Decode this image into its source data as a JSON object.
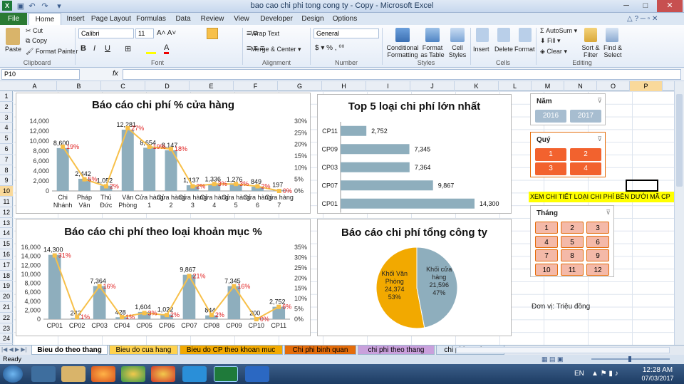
{
  "window": {
    "title": "bao cao chi phi tong cong ty - Copy  -  Microsoft Excel"
  },
  "tabs": [
    "File",
    "Home",
    "Insert",
    "Page Layout",
    "Formulas",
    "Data",
    "Review",
    "View",
    "Developer",
    "Design",
    "Options"
  ],
  "ribbon": {
    "clipboard": {
      "paste": "Paste",
      "cut": "Cut",
      "copy": "Copy",
      "format_painter": "Format Painter",
      "label": "Clipboard"
    },
    "font": {
      "name": "Calibri",
      "size": "11",
      "label": "Font"
    },
    "alignment": {
      "wrap": "Wrap Text",
      "merge": "Merge & Center",
      "label": "Alignment"
    },
    "number": {
      "format": "General",
      "label": "Number"
    },
    "styles": {
      "cond": "Conditional Formatting",
      "table": "Format as Table",
      "cell": "Cell Styles",
      "label": "Styles"
    },
    "cells": {
      "insert": "Insert",
      "delete": "Delete",
      "format": "Format",
      "label": "Cells"
    },
    "editing": {
      "autosum": "AutoSum",
      "fill": "Fill",
      "clear": "Clear",
      "sort": "Sort & Filter",
      "find": "Find & Select",
      "label": "Editing"
    }
  },
  "formula_bar": {
    "name_box": "P10",
    "fx": "fx",
    "content": ""
  },
  "columns": [
    "A",
    "B",
    "C",
    "D",
    "E",
    "F",
    "G",
    "H",
    "I",
    "J",
    "K",
    "L",
    "M",
    "N",
    "O",
    "P"
  ],
  "rows": [
    "1",
    "2",
    "3",
    "4",
    "5",
    "6",
    "7",
    "8",
    "9",
    "10",
    "11",
    "12",
    "13",
    "14",
    "15",
    "16",
    "17",
    "18",
    "19",
    "20",
    "21",
    "22",
    "23",
    "24"
  ],
  "charts": {
    "store": {
      "title": "Báo cáo chi phí % cửa hàng",
      "categories": [
        "Chi Nhánh",
        "Pháp Vân",
        "Thủ Đức",
        "Văn Phòng",
        "Cửa hàng 1",
        "Cửa hàng 2",
        "Cửa hàng 3",
        "Cửa hàng 4",
        "Cửa hàng 5",
        "Cửa hàng 6",
        "Cửa hàng 7"
      ],
      "values": [
        8600,
        2442,
        1052,
        12281,
        8654,
        8147,
        1137,
        1336,
        1276,
        849,
        197
      ],
      "value_labels": [
        "8,600",
        "2,442",
        "1,052",
        "12,281",
        "8,654",
        "8,147",
        "1,137",
        "1,336",
        "1,276",
        "849",
        "197"
      ],
      "pct": [
        19,
        5,
        2,
        27,
        19,
        18,
        2,
        3,
        3,
        2,
        0
      ],
      "pct_labels": [
        "19%",
        "5%",
        "2%",
        "27%",
        "19%",
        "18%",
        "2%",
        "3%",
        "3%",
        "2%",
        "0%"
      ],
      "yticks": [
        "14,000",
        "12,000",
        "10,000",
        "8,000",
        "6,000",
        "4,000",
        "2,000",
        "0"
      ],
      "y2ticks": [
        "30%",
        "25%",
        "20%",
        "15%",
        "10%",
        "5%",
        "0%"
      ]
    },
    "top5": {
      "title": "Top 5 loại chi phí lớn nhất",
      "categories": [
        "CP11",
        "CP09",
        "CP03",
        "CP07",
        "CP01"
      ],
      "values": [
        2752,
        7345,
        7364,
        9867,
        14300
      ],
      "value_labels": [
        "2,752",
        "7,345",
        "7,364",
        "9,867",
        "14,300"
      ]
    },
    "type": {
      "title": "Báo cáo chi phí theo loại khoản mục %",
      "categories": [
        "CP01",
        "CP02",
        "CP03",
        "CP04",
        "CP05",
        "CP06",
        "CP07",
        "CP08",
        "CP09",
        "CP10",
        "CP11"
      ],
      "values": [
        14300,
        243,
        7364,
        428,
        1604,
        1022,
        9867,
        844,
        7345,
        200,
        2752
      ],
      "value_labels": [
        "14,300",
        "243",
        "7,364",
        "428",
        "1,604",
        "1,022",
        "9,867",
        "844",
        "7,345",
        "200",
        "2,752"
      ],
      "pct": [
        31,
        1,
        16,
        1,
        3,
        2,
        21,
        2,
        16,
        0,
        6
      ],
      "pct_labels": [
        "31%",
        "1%",
        "16%",
        "1%",
        "3%",
        "2%",
        "21%",
        "2%",
        "16%",
        "0%",
        "6%"
      ],
      "yticks": [
        "16,000",
        "14,000",
        "12,000",
        "10,000",
        "8,000",
        "6,000",
        "4,000",
        "2,000",
        "0"
      ],
      "y2ticks": [
        "35%",
        "30%",
        "25%",
        "20%",
        "15%",
        "10%",
        "5%",
        "0%"
      ]
    },
    "total": {
      "title": "Báo cáo chi phí tổng công ty",
      "slices": [
        {
          "name": "Khối Văn Phòng",
          "value_label": "24,374",
          "pct_label": "53%",
          "value": 24374,
          "color": "#f2a900"
        },
        {
          "name": "Khối cửa hàng",
          "value_label": "21,596",
          "pct_label": "47%",
          "value": 21596,
          "color": "#8eaebd"
        }
      ]
    }
  },
  "chart_data": [
    {
      "type": "bar",
      "title": "Báo cáo chi phí % cửa hàng",
      "categories": [
        "Chi Nhánh",
        "Pháp Vân",
        "Thủ Đức",
        "Văn Phòng",
        "Cửa hàng 1",
        "Cửa hàng 2",
        "Cửa hàng 3",
        "Cửa hàng 4",
        "Cửa hàng 5",
        "Cửa hàng 6",
        "Cửa hàng 7"
      ],
      "series": [
        {
          "values": [
            8600,
            2442,
            1052,
            12281,
            8654,
            8147,
            1137,
            1336,
            1276,
            849,
            197
          ]
        },
        {
          "values": [
            19,
            5,
            2,
            27,
            19,
            18,
            2,
            3,
            3,
            2,
            0
          ]
        }
      ],
      "ylim": [
        0,
        14000
      ]
    },
    {
      "type": "bar",
      "title": "Top 5 loại chi phí lớn nhất",
      "categories": [
        "CP11",
        "CP09",
        "CP03",
        "CP07",
        "CP01"
      ],
      "values": [
        2752,
        7345,
        7364,
        9867,
        14300
      ]
    },
    {
      "type": "bar",
      "title": "Báo cáo chi phí theo loại khoản mục %",
      "categories": [
        "CP01",
        "CP02",
        "CP03",
        "CP04",
        "CP05",
        "CP06",
        "CP07",
        "CP08",
        "CP09",
        "CP10",
        "CP11"
      ],
      "series": [
        {
          "values": [
            14300,
            243,
            7364,
            428,
            1604,
            1022,
            9867,
            844,
            7345,
            200,
            2752
          ]
        },
        {
          "values": [
            31,
            1,
            16,
            1,
            3,
            2,
            21,
            2,
            16,
            0,
            6
          ]
        }
      ],
      "ylim": [
        0,
        16000
      ]
    },
    {
      "type": "pie",
      "title": "Báo cáo chi phí tổng công ty",
      "categories": [
        "Khối Văn Phòng",
        "Khối cửa hàng"
      ],
      "values": [
        24374,
        21596
      ]
    }
  ],
  "slicers": {
    "year": {
      "title": "Năm",
      "items": [
        "2016",
        "2017"
      ]
    },
    "quarter": {
      "title": "Quý",
      "items": [
        "1",
        "2",
        "3",
        "4"
      ]
    },
    "month": {
      "title": "Tháng",
      "items": [
        "1",
        "2",
        "3",
        "4",
        "5",
        "6",
        "7",
        "8",
        "9",
        "10",
        "11",
        "12"
      ]
    }
  },
  "banner": "XEM CHI TIẾT LOẠI CHI PHÍ BÊN DƯỚI MÃ CP",
  "unit_note": "Đơn vị: Triệu đồng",
  "sheet_tabs": [
    {
      "label": "Bieu do theo thang",
      "color": "#ffffff",
      "active": true
    },
    {
      "label": "Bieu do cua hang",
      "color": "#ffd24d"
    },
    {
      "label": "Bieu do CP theo khoan muc",
      "color": "#f2a900"
    },
    {
      "label": "Chi phi binh quan",
      "color": "#e46c0a"
    },
    {
      "label": "chi phi theo thang",
      "color": "#c9a0dc"
    },
    {
      "label": "chi phi cua hang",
      "color": "#dce6f2"
    }
  ],
  "status": {
    "left": "Ready"
  },
  "taskbar": {
    "lang": "EN",
    "time": "12:28 AM",
    "date": "07/03/2017"
  }
}
